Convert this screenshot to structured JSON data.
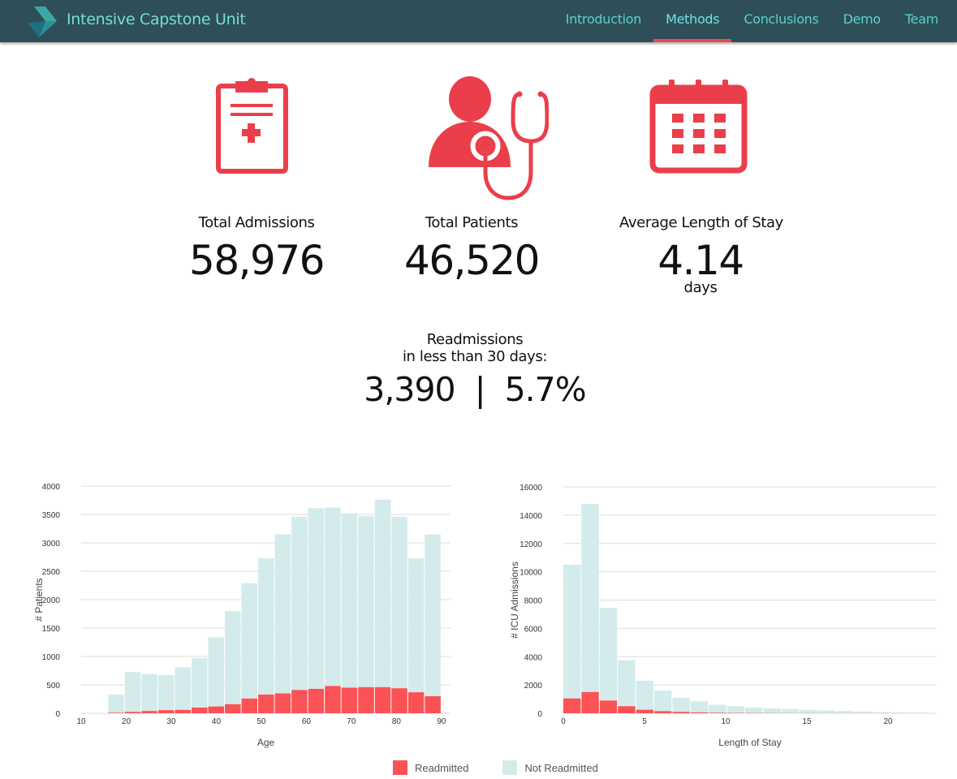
{
  "header": {
    "brand": "Intensive Capstone Unit",
    "nav": [
      {
        "label": "Introduction",
        "active": false
      },
      {
        "label": "Methods",
        "active": true
      },
      {
        "label": "Conclusions",
        "active": false
      },
      {
        "label": "Demo",
        "active": false
      },
      {
        "label": "Team",
        "active": false
      }
    ]
  },
  "colors": {
    "header_bg": "#2e4e58",
    "brand_text": "#73dfd8",
    "nav_text": "#58d3cc",
    "active_underline": "#ea4c56",
    "icon_red": "#ea3f4b",
    "readmitted": "#fb5256",
    "not_readmitted": "#d4ebeb"
  },
  "stats": [
    {
      "label": "Total Admissions",
      "value": "58,976",
      "unit": "",
      "icon": "clipboard-icon"
    },
    {
      "label": "Total Patients",
      "value": "46,520",
      "unit": "",
      "icon": "doctor-stethoscope-icon"
    },
    {
      "label": "Average Length of Stay",
      "value": "4.14",
      "unit": "days",
      "icon": "calendar-icon"
    }
  ],
  "readmissions": {
    "label_line1": "Readmissions",
    "label_line2": "in less than 30 days:",
    "value": "3,390  |  5.7%"
  },
  "legend": {
    "readmitted": "Readmitted",
    "not_readmitted": "Not Readmitted"
  },
  "chart_data": [
    {
      "type": "bar",
      "stacked": true,
      "xlabel": "Age",
      "ylabel": "# Patients",
      "xlim": [
        10,
        92
      ],
      "ylim": [
        0,
        4000
      ],
      "yticks": [
        0,
        500,
        1000,
        1500,
        2000,
        2500,
        3000,
        3500,
        4000
      ],
      "xticks": [
        10,
        20,
        30,
        40,
        50,
        60,
        70,
        80,
        90
      ],
      "bin_start": 16,
      "bin_width": 3.7,
      "grid": true,
      "series": [
        {
          "name": "Readmitted",
          "values": [
            10,
            25,
            40,
            55,
            60,
            100,
            120,
            160,
            260,
            330,
            350,
            410,
            430,
            480,
            450,
            460,
            460,
            440,
            370,
            300
          ]
        },
        {
          "name": "Not Readmitted",
          "values": [
            320,
            700,
            650,
            620,
            750,
            870,
            1220,
            1640,
            2030,
            2400,
            2800,
            3050,
            3180,
            3140,
            3070,
            3010,
            3300,
            3020,
            2360,
            2850
          ]
        }
      ]
    },
    {
      "type": "bar",
      "stacked": true,
      "xlabel": "Length of Stay",
      "ylabel": "# ICU Admissions",
      "xlim": [
        0,
        23
      ],
      "ylim": [
        0,
        16000
      ],
      "yticks": [
        0,
        2000,
        4000,
        6000,
        8000,
        10000,
        12000,
        14000,
        16000
      ],
      "xticks": [
        0,
        5,
        10,
        15,
        20
      ],
      "bin_start": 0,
      "bin_width": 1.12,
      "grid": true,
      "series": [
        {
          "name": "Readmitted",
          "values": [
            1050,
            1500,
            900,
            500,
            250,
            150,
            100,
            60,
            40,
            25,
            18,
            12,
            10,
            8,
            6,
            5,
            4,
            3,
            2,
            2
          ]
        },
        {
          "name": "Not Readmitted",
          "values": [
            9450,
            13300,
            6550,
            3250,
            2050,
            1450,
            1000,
            790,
            560,
            475,
            382,
            328,
            290,
            237,
            194,
            145,
            116,
            87,
            68,
            48
          ]
        }
      ]
    }
  ]
}
